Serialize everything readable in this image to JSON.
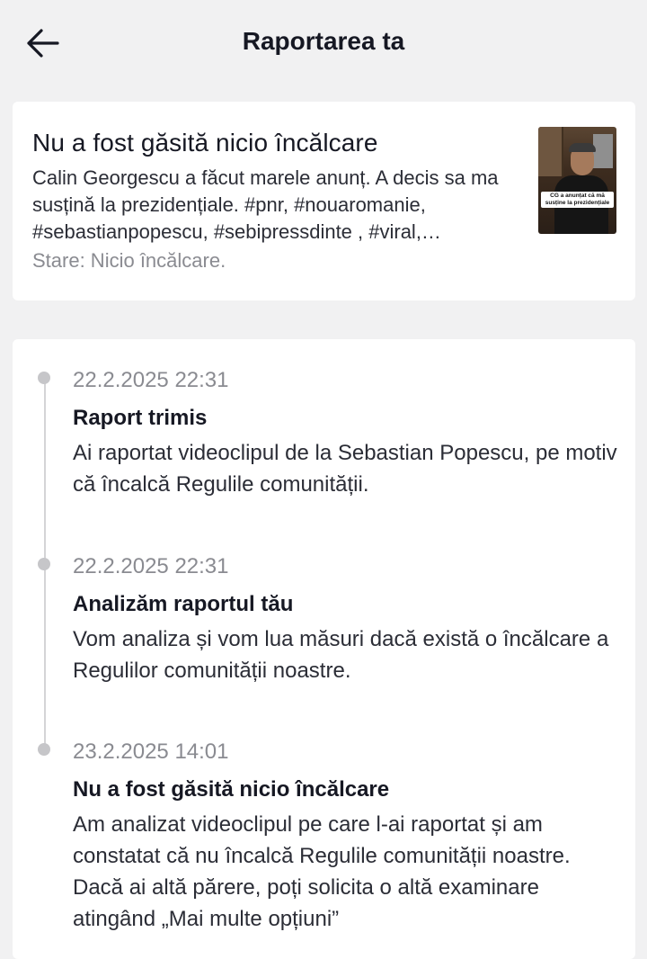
{
  "header": {
    "back_icon": "arrow-left-icon",
    "title": "Raportarea ta"
  },
  "video_card": {
    "title": "Nu a fost găsită nicio încălcare",
    "description": "Calin Georgescu a făcut marele anunț. A decis sa ma susțină la prezidențiale. #pnr, #nouaromanie, #sebastianpopescu, #sebipressdinte , #viral,…",
    "status": "Stare: Nicio încălcare.",
    "thumbnail_caption": "CG a anunțat că mă susține la prezidențiale"
  },
  "timeline": [
    {
      "date": "22.2.2025 22:31",
      "title": "Raport trimis",
      "text": "Ai raportat videoclipul de la Sebastian Popescu, pe motiv că încalcă Regulile comunității."
    },
    {
      "date": "22.2.2025 22:31",
      "title": "Analizăm raportul tău",
      "text": "Vom analiza și vom lua măsuri dacă există o încălcare a Regulilor comunității noastre."
    },
    {
      "date": "23.2.2025 14:01",
      "title": "Nu a fost găsită nicio încălcare",
      "text": "Am analizat videoclipul pe care l-ai raportat și am constatat că nu încalcă Regulile comunității noastre. Dacă ai altă părere, poți solicita o altă examinare atingând „Mai multe opțiuni”"
    }
  ]
}
